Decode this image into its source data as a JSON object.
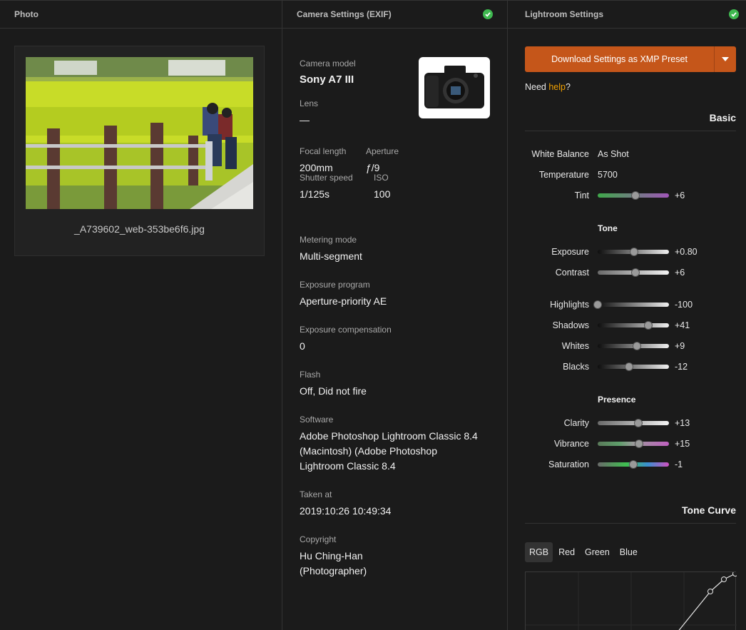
{
  "photo_panel": {
    "header": "Photo",
    "filename": "_A739602_web-353be6f6.jpg"
  },
  "exif_panel": {
    "header": "Camera Settings (EXIF)",
    "camera_model": {
      "label": "Camera model",
      "value": "Sony A7 III"
    },
    "lens": {
      "label": "Lens",
      "value": "—"
    },
    "focal_length": {
      "label": "Focal length",
      "value": "200mm"
    },
    "aperture": {
      "label": "Aperture",
      "value": "ƒ/9"
    },
    "shutter_speed": {
      "label": "Shutter speed",
      "value": "1/125s"
    },
    "iso": {
      "label": "ISO",
      "value": "100"
    },
    "metering_mode": {
      "label": "Metering mode",
      "value": "Multi-segment"
    },
    "exposure_program": {
      "label": "Exposure program",
      "value": "Aperture-priority AE"
    },
    "exposure_compensation": {
      "label": "Exposure compensation",
      "value": "0"
    },
    "flash": {
      "label": "Flash",
      "value": "Off, Did not fire"
    },
    "software": {
      "label": "Software",
      "line1": "Adobe Photoshop Lightroom Classic 8.4",
      "line2": "(Macintosh) (Adobe Photoshop",
      "line3": "Lightroom Classic 8.4"
    },
    "taken_at": {
      "label": "Taken at",
      "value": "2019:10:26 10:49:34"
    },
    "copyright": {
      "label": "Copyright",
      "line1": "Hu Ching-Han",
      "line2": "(Photographer)"
    }
  },
  "lr_panel": {
    "header": "Lightroom Settings",
    "download_label": "Download Settings as XMP Preset",
    "help_prefix": "Need ",
    "help_link": "help",
    "help_suffix": "?",
    "basic_title": "Basic",
    "white_balance": {
      "label": "White Balance",
      "value": "As Shot"
    },
    "temperature": {
      "label": "Temperature",
      "value": "5700"
    },
    "tint": {
      "label": "Tint",
      "value": "+6",
      "level": 0.53
    },
    "tone_title": "Tone",
    "exposure": {
      "label": "Exposure",
      "value": "+0.80",
      "level": 0.51
    },
    "contrast": {
      "label": "Contrast",
      "value": "+6",
      "level": 0.53
    },
    "highlights": {
      "label": "Highlights",
      "value": "-100",
      "level": 0.0
    },
    "shadows": {
      "label": "Shadows",
      "value": "+41",
      "level": 0.705
    },
    "whites": {
      "label": "Whites",
      "value": "+9",
      "level": 0.545
    },
    "blacks": {
      "label": "Blacks",
      "value": "-12",
      "level": 0.44
    },
    "presence_title": "Presence",
    "clarity": {
      "label": "Clarity",
      "value": "+13",
      "level": 0.565
    },
    "vibrance": {
      "label": "Vibrance",
      "value": "+15",
      "level": 0.575
    },
    "saturation": {
      "label": "Saturation",
      "value": "-1",
      "level": 0.495
    },
    "tone_curve_title": "Tone Curve",
    "curve_tabs": [
      "RGB",
      "Red",
      "Green",
      "Blue"
    ]
  },
  "colors": {
    "accent": "#c5561a",
    "link": "#f0a000",
    "ok": "#3fb950"
  }
}
